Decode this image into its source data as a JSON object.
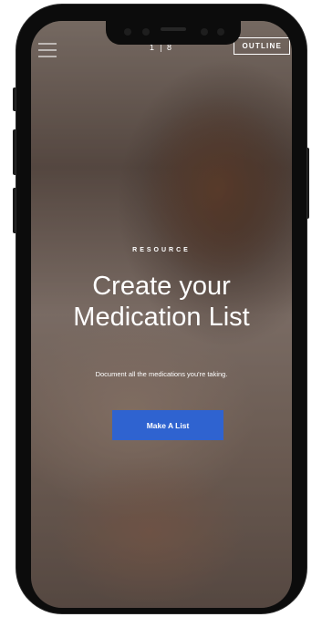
{
  "header": {
    "menu_icon": "hamburger-menu-icon",
    "pager_current": "1",
    "pager_total": "8",
    "outline_label": "OUTLINE"
  },
  "hero": {
    "eyebrow": "RESOURCE",
    "title_line1": "Create your",
    "title_line2": "Medication List",
    "subtitle": "Document all the medications you're taking.",
    "cta_label": "Make A List"
  },
  "colors": {
    "cta_background": "#2f63d0",
    "text": "#ffffff",
    "device_frame": "#0c0c0c"
  }
}
